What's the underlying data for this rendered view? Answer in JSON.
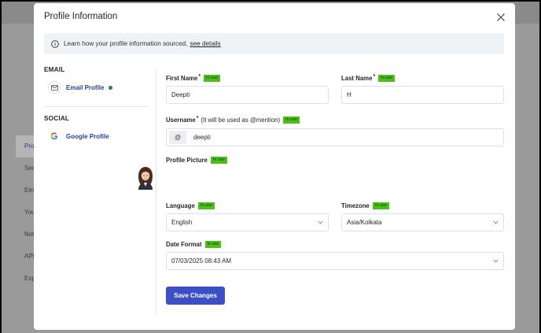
{
  "background": {
    "nav_items": [
      "Pro",
      "Sec",
      "Em",
      "You",
      "Not",
      "API",
      "Exp"
    ]
  },
  "modal": {
    "title": "Profile Information",
    "info": {
      "text": "Learn how your profile information sourced,",
      "link": "see details"
    }
  },
  "sources": {
    "email_section": "EMAIL",
    "email_provider": "Email Profile",
    "social_section": "SOCIAL",
    "social_provider": "Google Profile"
  },
  "form": {
    "badge": "In use",
    "first_name": {
      "label": "First Name",
      "required": "*",
      "value": "Deepti"
    },
    "last_name": {
      "label": "Last Name",
      "required": "*",
      "value": "H"
    },
    "username": {
      "label": "Username",
      "required": "*",
      "note": "(It will be used as @mention)",
      "prefix": "@",
      "value": "deepti"
    },
    "profile_picture": {
      "label": "Profile Picture"
    },
    "language": {
      "label": "Language",
      "value": "English"
    },
    "timezone": {
      "label": "Timezone",
      "value": "Asia/Kolkata"
    },
    "date_format": {
      "label": "Date Format",
      "value": "07/03/2025 08:43 AM"
    },
    "save_label": "Save Changes"
  },
  "colors": {
    "accent": "#3d4fc4",
    "badge": "#4cbf19",
    "status_dot": "#1a8754"
  }
}
